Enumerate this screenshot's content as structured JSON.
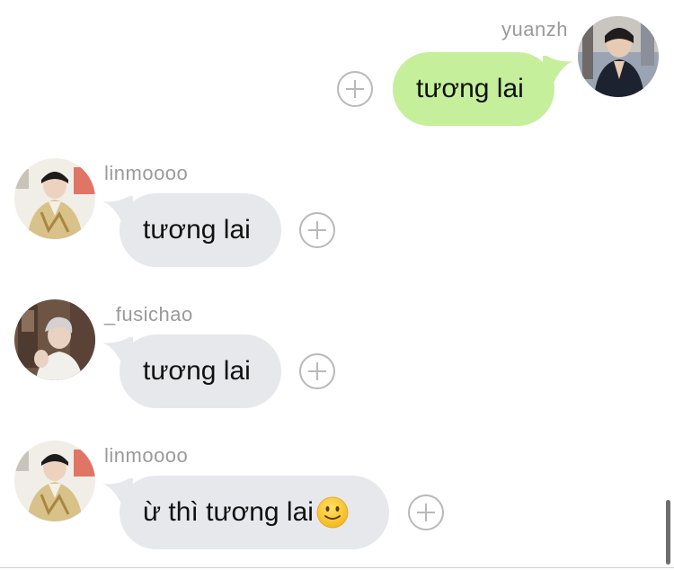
{
  "messages": [
    {
      "sender": "yuanzh",
      "text": "tương lai",
      "direction": "outgoing",
      "avatar": "photo-avatar-yuanzh"
    },
    {
      "sender": "linmoooo",
      "text": "tương lai",
      "direction": "incoming",
      "avatar": "photo-avatar-linmoooo"
    },
    {
      "sender": "_fusichao",
      "text": "tương lai",
      "direction": "incoming",
      "avatar": "photo-avatar-fusichao"
    },
    {
      "sender": "linmoooo",
      "text": "ừ thì tương lai",
      "emoji": "slightly-smiling-face-emoji",
      "direction": "incoming",
      "avatar": "photo-avatar-linmoooo"
    }
  ],
  "colors": {
    "outgoing_bubble": "#c5ef9b",
    "incoming_bubble": "#e6e8ec",
    "username": "#9a9a9a",
    "add_button": "#b9b9b9"
  },
  "icons": {
    "add_reaction": "plus-circle-icon"
  }
}
